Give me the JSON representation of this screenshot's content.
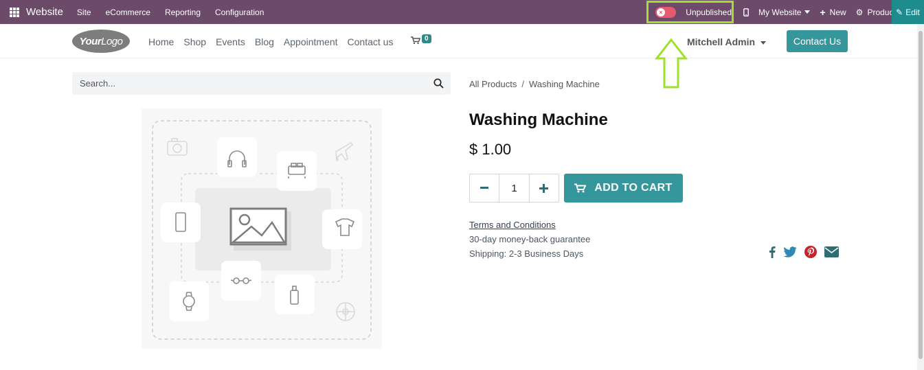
{
  "topbar": {
    "brand": "Website",
    "menu": [
      "Site",
      "eCommerce",
      "Reporting",
      "Configuration"
    ],
    "publish_status": "Unpublished",
    "my_website": "My Website",
    "new_label": "New",
    "product_label": "Product",
    "edit_label": "Edit",
    "bar_color": "#6b4a6a",
    "highlight_color": "#9ee02a"
  },
  "header": {
    "logo_text_bold": "Your",
    "logo_text": "Logo",
    "nav": [
      "Home",
      "Shop",
      "Events",
      "Blog",
      "Appointment",
      "Contact us"
    ],
    "cart_count": "0",
    "user_name": "Mitchell Admin",
    "contact_button": "Contact Us"
  },
  "search": {
    "placeholder": "Search..."
  },
  "breadcrumb": {
    "parent": "All Products",
    "separator": "/",
    "current": "Washing Machine"
  },
  "product": {
    "title": "Washing Machine",
    "price": "$ 1.00",
    "quantity": "1",
    "add_to_cart": "ADD TO CART",
    "terms": "Terms and Conditions",
    "guarantee": "30-day money-back guarantee",
    "shipping": "Shipping: 2-3 Business Days",
    "accent_color": "#35979c"
  },
  "social": [
    "facebook-icon",
    "twitter-icon",
    "pinterest-icon",
    "email-icon"
  ]
}
